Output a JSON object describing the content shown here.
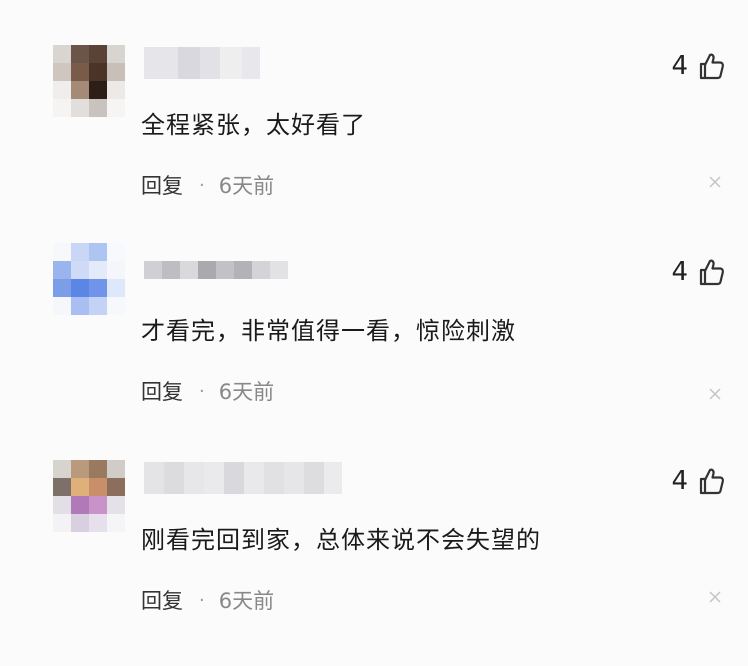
{
  "comments": [
    {
      "text": "全程紧张，太好看了",
      "likes": "4",
      "reply_label": "回复",
      "separator": "·",
      "time": "6天前",
      "avatar_colors": [
        "#d9d6d2",
        "#6b5548",
        "#5a4236",
        "#d8d4d0",
        "#cfc7bf",
        "#7a5a48",
        "#4b3327",
        "#c8c0b8",
        "#f0eeec",
        "#a68a78",
        "#2d1f18",
        "#ece9e6",
        "#f5f4f3",
        "#e2dedb",
        "#c9c3bf",
        "#f6f5f4"
      ],
      "name_colors": [
        "#e6e6ea",
        "#d8d8de",
        "#e1e1e6",
        "#eeeeef",
        "#e8e8ec"
      ]
    },
    {
      "text": "才看完，非常值得一看，惊险刺激",
      "likes": "4",
      "reply_label": "回复",
      "separator": "·",
      "time": "6天前",
      "avatar_colors": [
        "#f7f8fc",
        "#c9d6f5",
        "#aec4f3",
        "#f8f9fd",
        "#9ab4ee",
        "#cfdaf7",
        "#e3ebfb",
        "#f4f6fc",
        "#7c9de8",
        "#5b86e6",
        "#6f94ea",
        "#dfe7fa",
        "#f6f7fb",
        "#a9bff2",
        "#c3d2f5",
        "#f7f8fc"
      ],
      "name_colors": [
        "#d0d0d4",
        "#bdbdc2",
        "#d9d9dc",
        "#a9a9ae",
        "#c1c1c6",
        "#b2b2b7",
        "#d4d4d8",
        "#e2e2e4"
      ]
    },
    {
      "text": "刚看完回到家，总体来说不会失望的",
      "likes": "4",
      "reply_label": "回复",
      "separator": "·",
      "time": "6天前",
      "avatar_colors": [
        "#d7d3cf",
        "#b99a7c",
        "#9a7a5e",
        "#d1ccc7",
        "#7d7068",
        "#e0b07a",
        "#c98f6a",
        "#8b6e5c",
        "#e3dfe6",
        "#b07ab8",
        "#c992c9",
        "#e5e1e8",
        "#f3f2f4",
        "#d8cfe1",
        "#e6e0ec",
        "#f5f4f6"
      ],
      "name_colors": [
        "#e4e4e7",
        "#dcdcdf",
        "#e7e7ea",
        "#eaeaed",
        "#d9d9dd",
        "#e9e9ec",
        "#e1e1e4",
        "#e6e6e9",
        "#dddde0",
        "#ebebee"
      ]
    }
  ]
}
